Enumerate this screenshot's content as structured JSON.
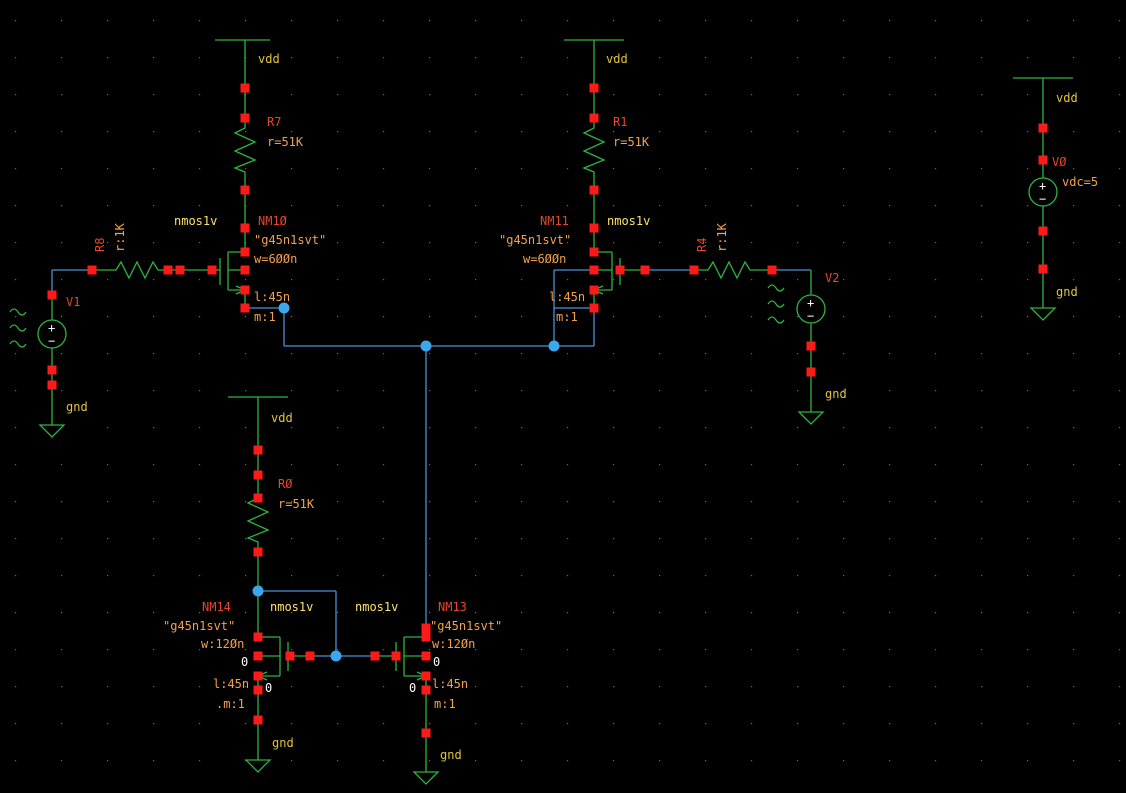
{
  "colors": {
    "background": "#000000",
    "device_wire": "#2cb53f",
    "net_wire": "#4a8fd6",
    "pin": "#ff1a1a",
    "junction": "#3ba8ee",
    "instance_name": "#e8452c",
    "parameter": "#f4a14a",
    "net_label": "#e3c43a",
    "cell_name": "#ffe26a"
  },
  "labels": {
    "vdd": "vdd",
    "gnd": "gnd",
    "zero": "0"
  },
  "resistors": {
    "R7": {
      "name": "R7",
      "value": "r=51K"
    },
    "R1": {
      "name": "R1",
      "value": "r=51K"
    },
    "R0": {
      "name": "RØ",
      "value": "r=51K"
    },
    "R8": {
      "name": "R8",
      "value": "r:1K"
    },
    "R4": {
      "name": "R4",
      "value": "r:1K"
    }
  },
  "sources": {
    "V0": {
      "name": "VØ",
      "value": "vdc=5"
    },
    "V1": {
      "name": "V1"
    },
    "V2": {
      "name": "V2"
    }
  },
  "transistors": {
    "NM10": {
      "name": "NM1Ø",
      "cell": "nmos1v",
      "model": "\"g45n1svt\"",
      "w": "w=6ØØn",
      "l": "l:45n",
      "m": "m:1"
    },
    "NM11": {
      "name": "NM11",
      "cell": "nmos1v",
      "model": "\"g45n1svt\"",
      "w": "w=6ØØn",
      "l": "l:45n",
      "m": "m:1"
    },
    "NM14": {
      "name": "NM14",
      "cell": "nmos1v",
      "model": "\"g45n1svt\"",
      "w": "w:12Øn",
      "l": "l:45n",
      "m": ".m:1"
    },
    "NM13": {
      "name": "NM13",
      "cell": "nmos1v",
      "model": "\"g45n1svt\"",
      "w": "w:12Øn",
      "l": "l:45n",
      "m": "m:1"
    }
  }
}
